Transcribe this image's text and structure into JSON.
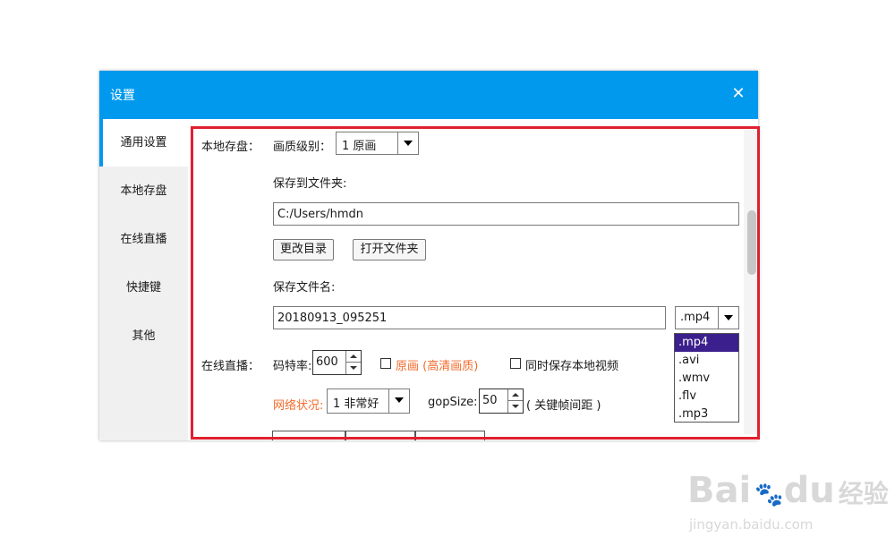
{
  "dialog": {
    "title": "设置"
  },
  "sidebar": {
    "items": [
      {
        "label": "通用设置",
        "active": true
      },
      {
        "label": "本地存盘",
        "active": false
      },
      {
        "label": "在线直播",
        "active": false
      },
      {
        "label": "快捷键",
        "active": false
      },
      {
        "label": "其他",
        "active": false
      }
    ]
  },
  "local": {
    "section_label": "本地存盘：",
    "quality_label": "画质级别：",
    "quality_value": "1 原画",
    "folder_label": "保存到文件夹:",
    "folder_value": "C:/Users/hmdn",
    "change_dir": "更改目录",
    "open_folder": "打开文件夹",
    "filename_label": "保存文件名:",
    "filename_value": "20180913_095251",
    "ext_value": ".mp4",
    "ext_options": [
      ".mp4",
      ".avi",
      ".wmv",
      ".flv",
      ".mp3"
    ]
  },
  "live": {
    "section_label": "在线直播：",
    "bitrate_label": "码特率:",
    "bitrate_value": "600",
    "original_label": "原画 (高清画质)",
    "also_save_label": "同时保存本地视频",
    "network_label": "网络状况:",
    "network_value": "1 非常好",
    "gop_label": "gopSize:",
    "gop_value": "50",
    "gop_hint": "( 关键帧间距 )"
  },
  "watermark": {
    "brand": "Bai",
    "brand2": "du",
    "brand_cn": "经验",
    "url": "jingyan.baidu.com"
  },
  "colors": {
    "accent": "#0099ee",
    "highlight": "#e02030",
    "warning_text": "#f26b2c",
    "selected": "#3b1f8c"
  }
}
